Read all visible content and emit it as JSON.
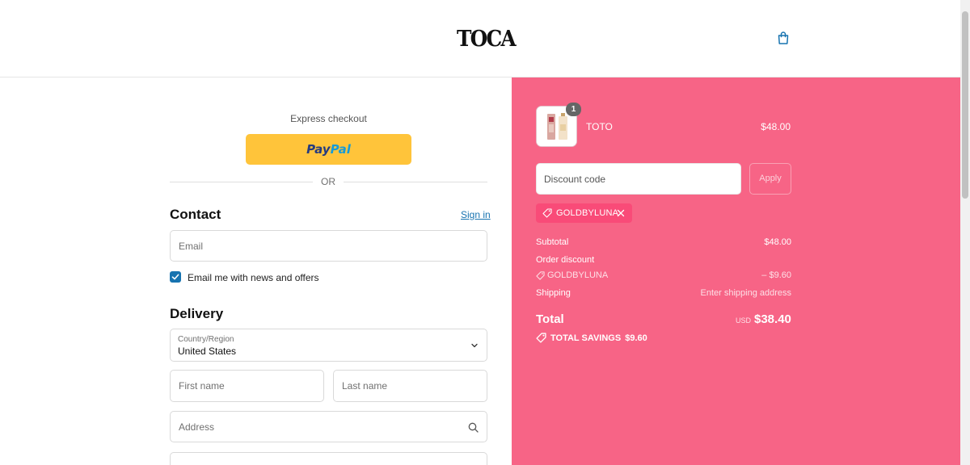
{
  "header": {
    "logo": "TOCA"
  },
  "express": {
    "title": "Express checkout",
    "paypal_part1": "Pay",
    "paypal_part2": "Pal",
    "or_label": "OR"
  },
  "contact": {
    "title": "Contact",
    "sign_in": "Sign in",
    "email_placeholder": "Email",
    "newsletter_label": "Email me with news and offers",
    "newsletter_checked": true
  },
  "delivery": {
    "title": "Delivery",
    "country_label": "Country/Region",
    "country_value": "United States",
    "first_name_placeholder": "First name",
    "last_name_placeholder": "Last name",
    "address_placeholder": "Address"
  },
  "summary": {
    "product_name": "TOTO",
    "product_price": "$48.00",
    "quantity": "1",
    "discount_placeholder": "Discount code",
    "apply_label": "Apply",
    "applied_code": "GOLDBYLUNA",
    "subtotal_label": "Subtotal",
    "subtotal_value": "$48.00",
    "order_discount_label": "Order discount",
    "discount_code": "GOLDBYLUNA",
    "discount_value": "– $9.60",
    "shipping_label": "Shipping",
    "shipping_value": "Enter shipping address",
    "total_label": "Total",
    "total_currency": "USD",
    "total_value": "$38.40",
    "savings_label": "TOTAL SAVINGS",
    "savings_value": "$9.60"
  },
  "colors": {
    "panel_bg": "#f76486",
    "paypal_yellow": "#ffc43a",
    "link_blue": "#1773b0",
    "chip_bg": "#f94b78"
  }
}
